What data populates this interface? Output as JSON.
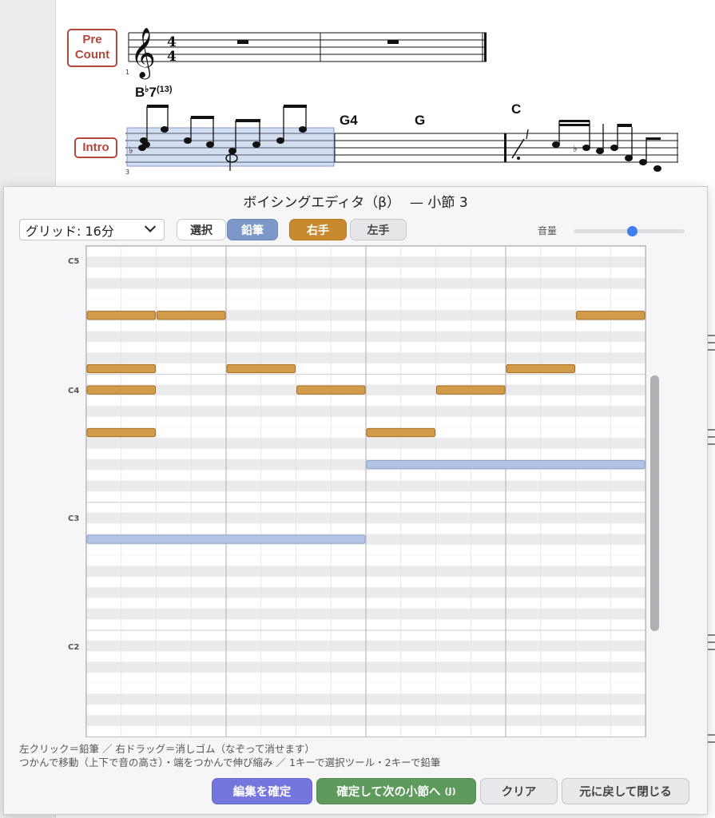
{
  "score": {
    "sections": [
      {
        "label_line1": "Pre",
        "label_line2": "Count"
      },
      {
        "label": "Intro"
      }
    ],
    "chords": [
      {
        "root": "B",
        "accidental": "♭",
        "quality": "7",
        "ext": "(13)"
      },
      {
        "name": "G4"
      },
      {
        "name": "G"
      },
      {
        "name": "C"
      }
    ],
    "measure_numbers": [
      "1",
      "3"
    ]
  },
  "dialog": {
    "title": "ボイシングエディタ（β）",
    "subtitle": "— 小節 3",
    "toolbar": {
      "grid_label": "グリッド: 16分",
      "select_label": "選択",
      "pencil_label": "鉛筆",
      "right_hand_label": "右手",
      "left_hand_label": "左手",
      "volume_label": "音量",
      "volume_level": 0.5
    },
    "pitch_labels": [
      "C5",
      "C4",
      "C3",
      "C2"
    ],
    "roll": {
      "rows": 46,
      "steps": 16,
      "right_notes": [
        {
          "row": 6,
          "start": 0,
          "len": 2
        },
        {
          "row": 6,
          "start": 2,
          "len": 2
        },
        {
          "row": 6,
          "start": 14,
          "len": 2
        },
        {
          "row": 11,
          "start": 0,
          "len": 2
        },
        {
          "row": 11,
          "start": 4,
          "len": 2
        },
        {
          "row": 11,
          "start": 12,
          "len": 2
        },
        {
          "row": 13,
          "start": 0,
          "len": 2
        },
        {
          "row": 13,
          "start": 6,
          "len": 2
        },
        {
          "row": 13,
          "start": 10,
          "len": 2
        },
        {
          "row": 17,
          "start": 0,
          "len": 2
        },
        {
          "row": 17,
          "start": 8,
          "len": 2
        }
      ],
      "left_notes": [
        {
          "row": 20,
          "start": 8,
          "len": 8
        },
        {
          "row": 27,
          "start": 0,
          "len": 8
        }
      ],
      "colors": {
        "right_fill": "#d29b4a",
        "right_border": "#a56f24",
        "left_fill": "#b2c3e6",
        "left_border": "#8ea4cf"
      }
    },
    "help_line1": "左クリック＝鉛筆 ／ 右ドラッグ＝消しゴム（なぞって消せます）",
    "help_line2": "つかんで移動（上下で音の高さ）・端をつかんで伸び縮み ／ 1キーで選択ツール・2キーで鉛筆",
    "buttons": {
      "confirm": "編集を確定",
      "next": "確定して次の小節へ",
      "next_hint": "(J)",
      "clear": "クリア",
      "revert": "元に戻して閉じる"
    }
  }
}
